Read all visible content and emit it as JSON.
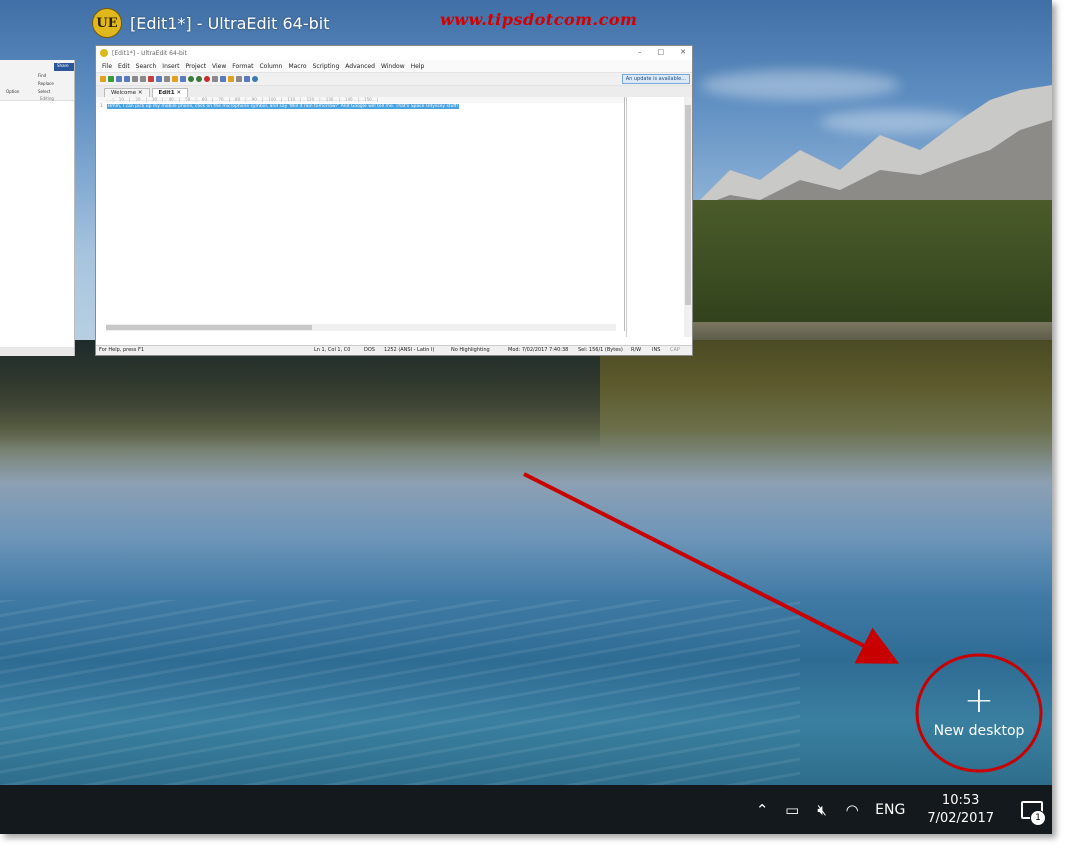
{
  "watermark": "www.tipsdotcom.com",
  "thumbnail": {
    "app_logo": "UE",
    "title": "[Edit1*] - UltraEdit 64-bit"
  },
  "ultraedit": {
    "titlebar": "[Edit1*] - UltraEdit 64-bit",
    "menu": [
      "File",
      "Edit",
      "Search",
      "Insert",
      "Project",
      "View",
      "Format",
      "Column",
      "Macro",
      "Scripting",
      "Advanced",
      "Window",
      "Help"
    ],
    "update_notice": "An update is available...",
    "tabs": [
      "Welcome",
      "Edit1"
    ],
    "line_number": "1",
    "line_text": "Hmm, I can pick up my mobile phone, click on the microphone symbol, and say 'Will it rain tomorrow?' And Google will tell me. That's Space Odyssey stuff!",
    "status": {
      "help": "For Help, press F1",
      "position": "Ln 1, Col 1, C0",
      "line_ending": "DOS",
      "encoding": "1252  (ANSI - Latin I)",
      "highlighting": "No Highlighting",
      "modified": "Mod: 7/02/2017 7:40:38",
      "selection": "Sel: 156/1 (Bytes)",
      "rw": "R/W",
      "ins": "INS",
      "cap": "CAP"
    }
  },
  "side_window": {
    "share": "Share",
    "find": "Find",
    "replace": "Replace",
    "select": "Select",
    "editing": "Editing",
    "options": "Option"
  },
  "new_desktop": {
    "label": "New desktop"
  },
  "taskbar": {
    "language": "ENG",
    "time": "10:53",
    "date": "7/02/2017",
    "notification_count": "1"
  },
  "colors": {
    "annotation": "#c80000",
    "taskbar": "#14191d"
  }
}
